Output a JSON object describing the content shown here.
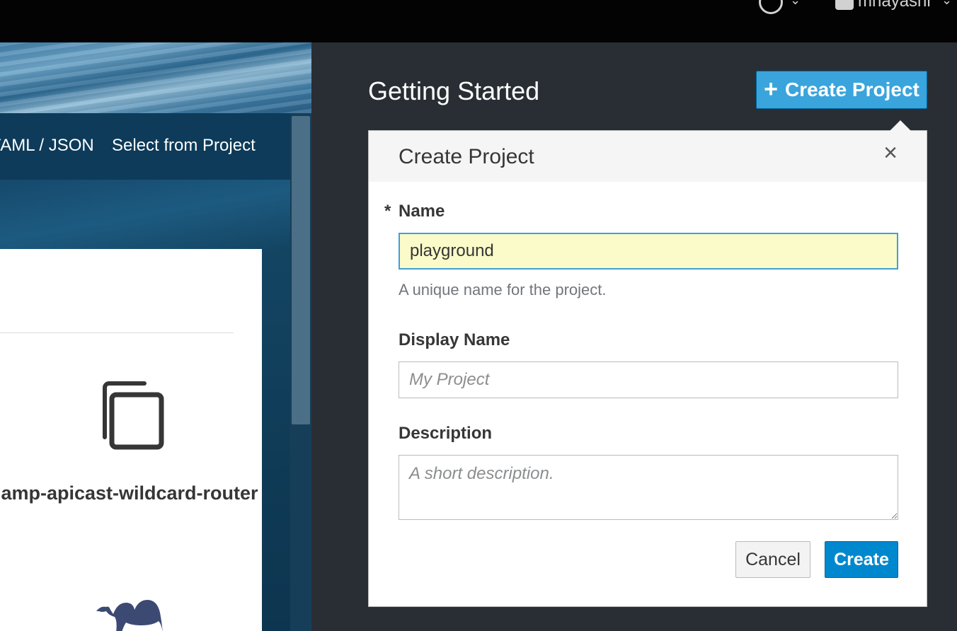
{
  "topbar": {
    "help_icon": "question-circle-icon",
    "user_icon": "user-icon",
    "user_name": "mhayashi"
  },
  "catalog": {
    "tabs": [
      {
        "label": "YAML / JSON"
      },
      {
        "label": "Select from Project"
      }
    ],
    "items": [
      {
        "icon": "copy-icon",
        "title": "amp-apicast-wildcard-router"
      },
      {
        "icon": "camel-icon",
        "title": ""
      }
    ]
  },
  "getting_started": {
    "title": "Getting Started",
    "create_project_button": "Create Project",
    "create_project_button_icon": "plus-icon"
  },
  "popover": {
    "title": "Create Project",
    "close_icon": "close-icon",
    "required_marker": "*",
    "name_label": "Name",
    "name_value": "playground",
    "name_help": "A unique name for the project.",
    "display_name_label": "Display Name",
    "display_name_placeholder": "My Project",
    "display_name_value": "",
    "description_label": "Description",
    "description_placeholder": "A short description.",
    "description_value": "",
    "cancel_label": "Cancel",
    "create_label": "Create"
  },
  "colors": {
    "primary_button": "#0088ce",
    "create_project_button": "#39a5dc",
    "panel_bg": "#292e34",
    "focused_input_bg": "#fafbc8"
  }
}
